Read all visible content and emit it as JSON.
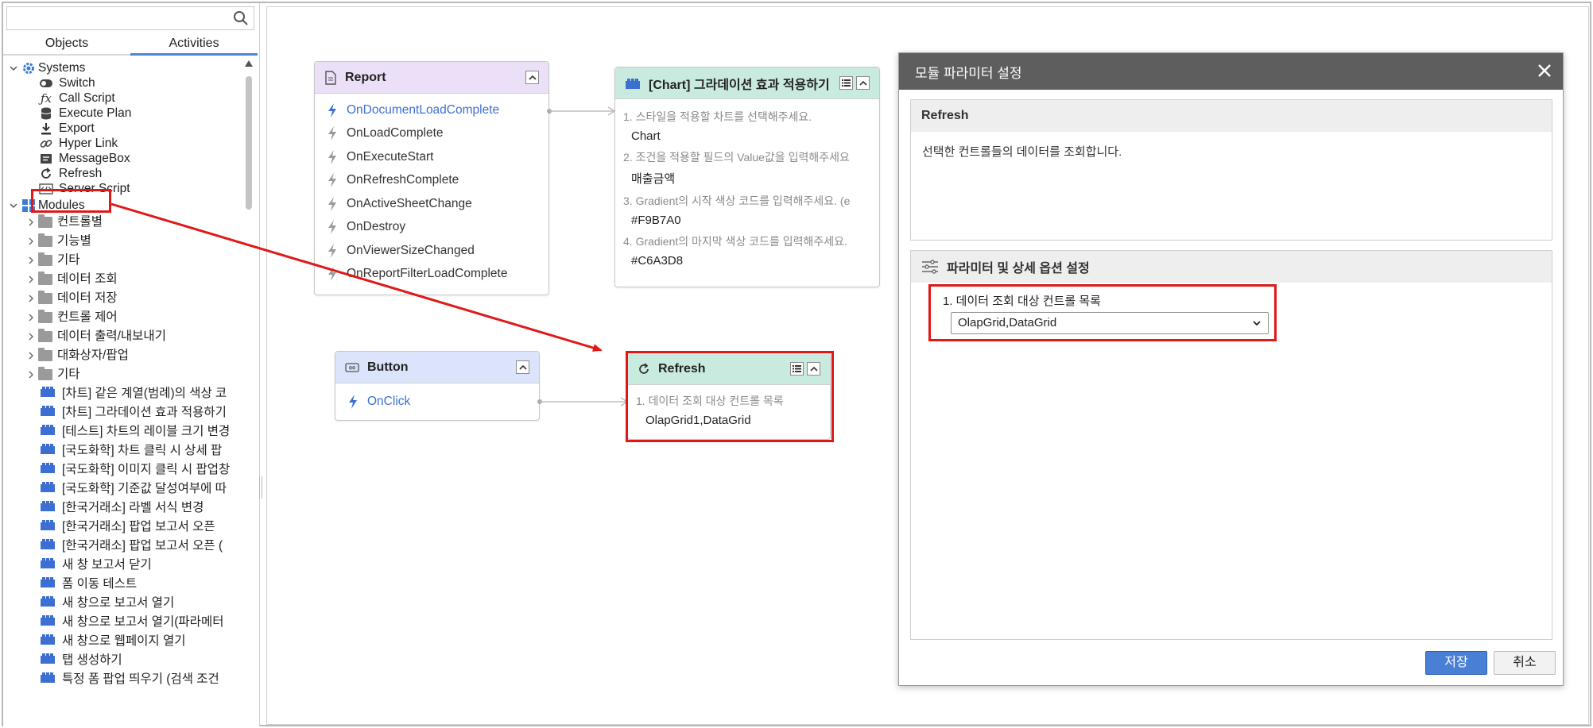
{
  "colors": {
    "accent": "#4a86d9",
    "annotation_red": "#e01818",
    "module_blue": "#3c6fd1",
    "dialog_title_bg": "#5e5e5e"
  },
  "left": {
    "search": {
      "value": "",
      "placeholder": "",
      "icon": "search-icon"
    },
    "tabs": [
      {
        "label": "Objects"
      },
      {
        "label": "Activities",
        "active": true
      }
    ],
    "systems": {
      "label": "Systems",
      "items": [
        {
          "label": "Switch",
          "icon": "toggle-icon"
        },
        {
          "label": "Call Script",
          "icon": "fx-icon"
        },
        {
          "label": "Execute Plan",
          "icon": "database-icon"
        },
        {
          "label": "Export",
          "icon": "download-icon"
        },
        {
          "label": "Hyper Link",
          "icon": "link-icon"
        },
        {
          "label": "MessageBox",
          "icon": "message-icon"
        },
        {
          "label": "Refresh",
          "icon": "refresh-icon"
        },
        {
          "label": "Server Script",
          "icon": "code-icon"
        }
      ]
    },
    "modules": {
      "label": "Modules",
      "folders": [
        "컨트롤별",
        "기능별",
        "기타",
        "데이터 조회",
        "데이터 저장",
        "컨트롤 제어",
        "데이터 출력/내보내기",
        "대화상자/팝업",
        "기타"
      ],
      "items": [
        "[차트] 같은 계열(범례)의 색상 코",
        "[차트] 그라데이션 효과 적용하기",
        "[테스트] 차트의 레이블 크기 변경",
        "[국도화학] 차트 클릭 시 상세 팝",
        "[국도화학] 이미지 클릭 시 팝업창",
        "[국도화학] 기준값 달성여부에 따",
        "[한국거래소] 라벨 서식 변경",
        "[한국거래소] 팝업 보고서 오픈",
        "[한국거래소] 팝업 보고서 오픈 (",
        "새 창 보고서 닫기",
        "폼 이동 테스트",
        "새 창으로 보고서 열기",
        "새 창으로 보고서 열기(파라메터",
        "새 창으로 웹페이지 열기",
        "탭 생성하기",
        "특정 폼 팝업 띄우기 (검색 조건"
      ]
    }
  },
  "nodes": {
    "report": {
      "title": "Report",
      "events": [
        "OnDocumentLoadComplete",
        "OnLoadComplete",
        "OnExecuteStart",
        "OnRefreshComplete",
        "OnActiveSheetChange",
        "OnDestroy",
        "OnViewerSizeChanged",
        "OnReportFilterLoadComplete"
      ]
    },
    "chart": {
      "title": "[Chart] 그라데이션 효과 적용하기",
      "params": [
        {
          "label": "1. 스타일을 적용할 차트를 선택해주세요.",
          "value": "Chart"
        },
        {
          "label": "2. 조건을 적용할 필드의 Value값을 입력해주세요",
          "value": "매출금액"
        },
        {
          "label": "3. Gradient의 시작 색상 코드를 입력해주세요. (e",
          "value": "#F9B7A0"
        },
        {
          "label": "4. Gradient의 마지막 색상 코드를 입력해주세요.",
          "value": "#C6A3D8"
        }
      ]
    },
    "button": {
      "title": "Button",
      "events": [
        "OnClick"
      ]
    },
    "refresh": {
      "title": "Refresh",
      "params": [
        {
          "label": "1. 데이터 조회 대상 컨트롤 목록",
          "value": "OlapGrid1,DataGrid"
        }
      ]
    }
  },
  "dialog": {
    "title": "모듈 파라미터 설정",
    "section1": {
      "title": "Refresh",
      "description": "선택한 컨트롤들의 데이터를 조회합니다."
    },
    "section2": {
      "title": "파라미터 및 상세 옵션 설정",
      "param_label": "1. 데이터 조회 대상 컨트롤 목록",
      "select_value": "OlapGrid,DataGrid"
    },
    "save_label": "저장",
    "cancel_label": "취소"
  }
}
